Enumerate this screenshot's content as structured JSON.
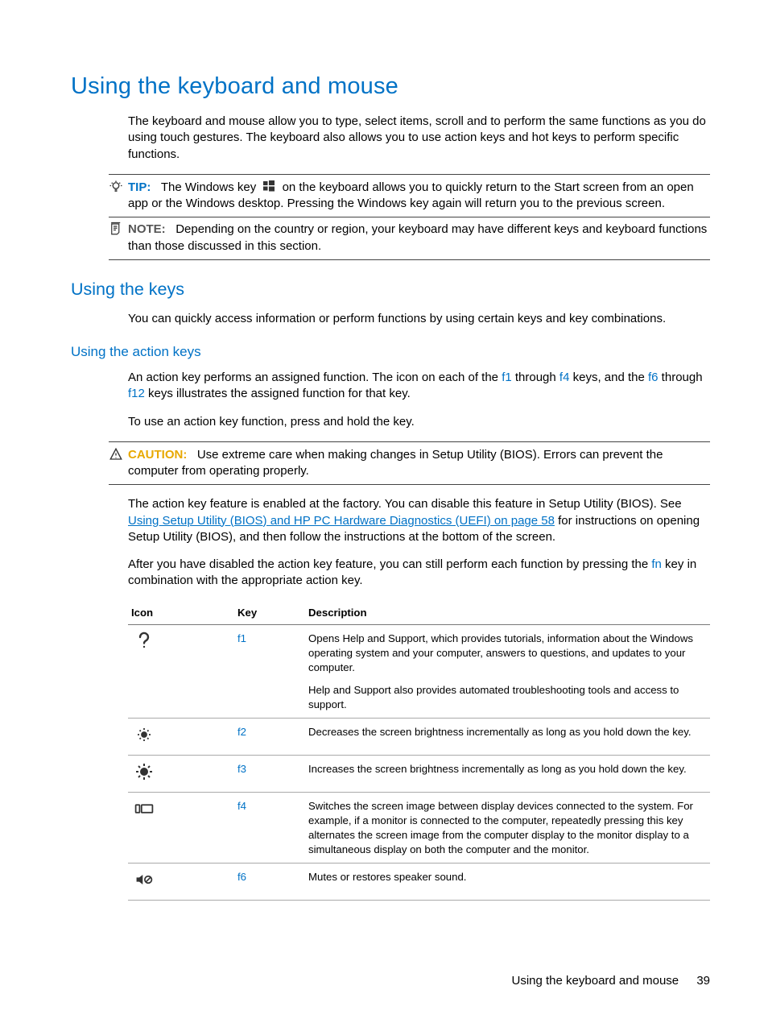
{
  "h1": "Using the keyboard and mouse",
  "intro": "The keyboard and mouse allow you to type, select items, scroll and to perform the same functions as you do using touch gestures. The keyboard also allows you to use action keys and hot keys to perform specific functions.",
  "tip": {
    "label": "TIP:",
    "pre": "The Windows key",
    "post": "on the keyboard allows you to quickly return to the Start screen from an open app or the Windows desktop. Pressing the Windows key again will return you to the previous screen."
  },
  "note": {
    "label": "NOTE:",
    "text": "Depending on the country or region, your keyboard may have different keys and keyboard functions than those discussed in this section."
  },
  "h2": "Using the keys",
  "keys_intro": "You can quickly access information or perform functions by using certain keys and key combinations.",
  "h3": "Using the action keys",
  "action_p1_a": "An action key performs an assigned function. The icon on each of the ",
  "action_p1_b": " through ",
  "action_p1_c": " keys, and the ",
  "action_p1_d": " through ",
  "action_p1_e": " keys illustrates the assigned function for that key.",
  "f1": "f1",
  "f4": "f4",
  "f6": "f6",
  "f12": "f12",
  "action_p2": "To use an action key function, press and hold the key.",
  "caution": {
    "label": "CAUTION:",
    "text": "Use extreme care when making changes in Setup Utility (BIOS). Errors can prevent the computer from operating properly."
  },
  "action_p3_a": "The action key feature is enabled at the factory. You can disable this feature in Setup Utility (BIOS). See ",
  "action_p3_link": "Using Setup Utility (BIOS) and HP PC Hardware Diagnostics (UEFI) on page 58",
  "action_p3_b": " for instructions on opening Setup Utility (BIOS), and then follow the instructions at the bottom of the screen.",
  "action_p4_a": "After you have disabled the action key feature, you can still perform each function by pressing the ",
  "fn": "fn",
  "action_p4_b": " key in combination with the appropriate action key.",
  "table": {
    "h_icon": "Icon",
    "h_key": "Key",
    "h_desc": "Description",
    "rows": [
      {
        "key": "f1",
        "desc1": "Opens Help and Support, which provides tutorials, information about the Windows operating system and your computer, answers to questions, and updates to your computer.",
        "desc2": "Help and Support also provides automated troubleshooting tools and access to support."
      },
      {
        "key": "f2",
        "desc1": "Decreases the screen brightness incrementally as long as you hold down the key."
      },
      {
        "key": "f3",
        "desc1": "Increases the screen brightness incrementally as long as you hold down the key."
      },
      {
        "key": "f4",
        "desc1": "Switches the screen image between display devices connected to the system. For example, if a monitor is connected to the computer, repeatedly pressing this key alternates the screen image from the computer display to the monitor display to a simultaneous display on both the computer and the monitor."
      },
      {
        "key": "f6",
        "desc1": "Mutes or restores speaker sound."
      }
    ]
  },
  "footer": {
    "title": "Using the keyboard and mouse",
    "page": "39"
  }
}
